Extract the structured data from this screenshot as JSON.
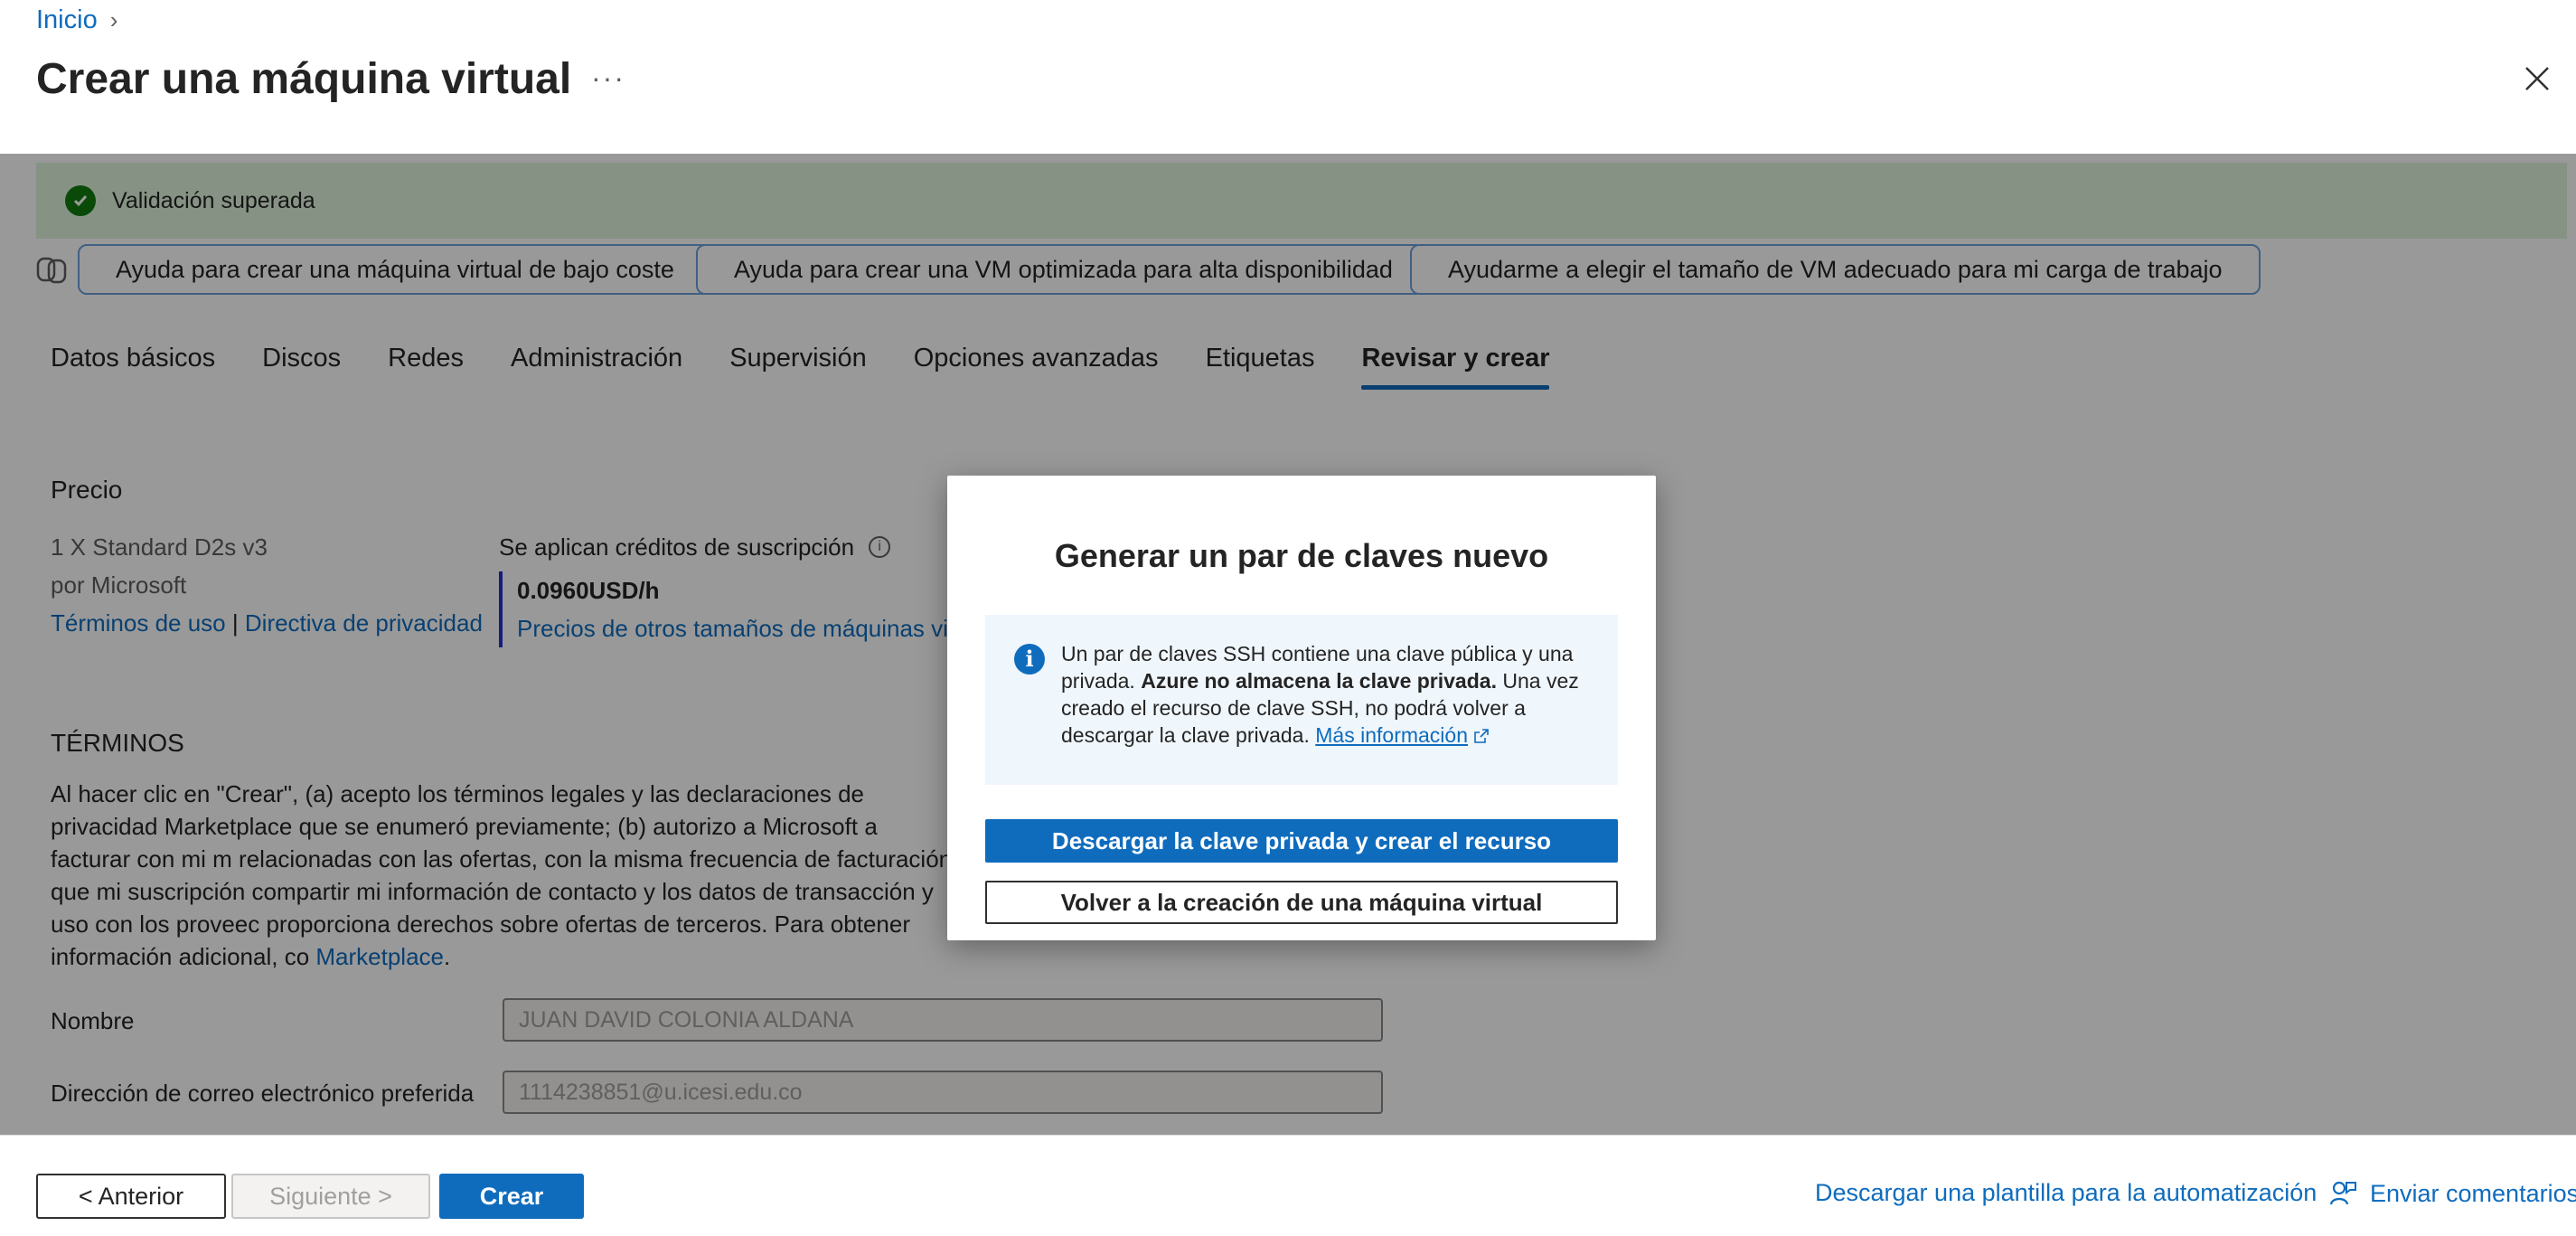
{
  "header": {
    "breadcrumb": "Inicio",
    "title": "Crear una máquina virtual",
    "more": "···"
  },
  "validation": {
    "text": "Validación superada"
  },
  "copilot_chips": [
    "Ayuda para crear una máquina virtual de bajo coste",
    "Ayuda para crear una VM optimizada para alta disponibilidad",
    "Ayudarme a elegir el tamaño de VM adecuado para mi carga de trabajo"
  ],
  "tabs": [
    "Datos básicos",
    "Discos",
    "Redes",
    "Administración",
    "Supervisión",
    "Opciones avanzadas",
    "Etiquetas",
    "Revisar y crear"
  ],
  "active_tab": "Revisar y crear",
  "price": {
    "section": "Precio",
    "sku": "1 X Standard D2s v3",
    "publisher": "por Microsoft",
    "terms_link": "Términos de uso",
    "separator": "|",
    "privacy_link": "Directiva de privacidad",
    "credits": "Se aplican créditos de suscripción",
    "value": "0.0960USD/h",
    "other_sizes": "Precios de otros tamaños de máquinas vir"
  },
  "terms": {
    "section": "TÉRMINOS",
    "text": "Al hacer clic en \"Crear\", (a) acepto los términos legales y las declaraciones de privacidad Marketplace que se enumeró previamente; (b) autorizo a Microsoft a facturar con mi m relacionadas con las ofertas, con la misma frecuencia de facturación que mi suscripción compartir mi información de contacto y los datos de transacción y uso con los proveec proporciona derechos sobre ofertas de terceros. Para obtener información adicional, co",
    "marketplace_link": "Marketplace",
    "period": "."
  },
  "fields": {
    "name_label": "Nombre",
    "name_value": "JUAN DAVID COLONIA ALDANA",
    "email_label": "Dirección de correo electrónico preferida",
    "email_value": "1114238851@u.icesi.edu.co"
  },
  "footer": {
    "prev": "< Anterior",
    "next": "Siguiente >",
    "create": "Crear",
    "template_link": "Descargar una plantilla para la automatización",
    "feedback_link": "Enviar comentarios"
  },
  "dialog": {
    "title": "Generar un par de claves nuevo",
    "info_part1": "Un par de claves SSH contiene una clave pública y una privada. ",
    "info_bold": "Azure no almacena la clave privada.",
    "info_part2": " Una vez creado el recurso de clave SSH, no podrá volver a descargar la clave privada. ",
    "info_link": "Más información",
    "primary": "Descargar la clave privada y crear el recurso",
    "secondary": "Volver a la creación de una máquina virtual"
  },
  "colors": {
    "accent": "#0f6cbd",
    "success": "#107c10",
    "success_bg": "#dff6dd"
  }
}
